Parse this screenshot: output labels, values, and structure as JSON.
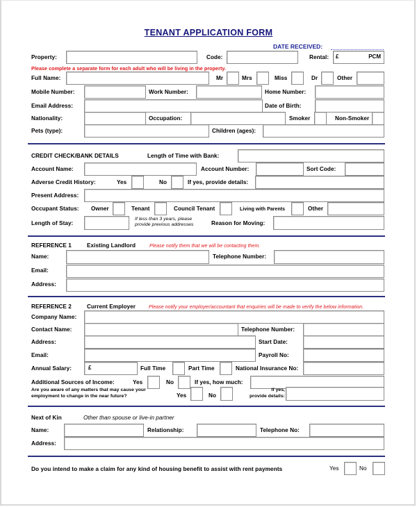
{
  "form": {
    "title": "TENANT APPLICATION FORM",
    "date_received_label": "DATE RECEIVED:",
    "property_label": "Property:",
    "code_label": "Code:",
    "rental_label": "Rental:",
    "rental_currency": "£",
    "rental_unit": "PCM",
    "separate_form_notice": "Please complete a separate form for each adult who will be living in the property."
  },
  "personal": {
    "full_name_label": "Full Name:",
    "titles": [
      "Mr",
      "Mrs",
      "Miss",
      "Dr",
      "Other"
    ],
    "mobile_label": "Mobile Number:",
    "work_label": "Work Number:",
    "home_label": "Home Number:",
    "email_label": "Email Address:",
    "dob_label": "Date of Birth:",
    "nationality_label": "Nationality:",
    "occupation_label": "Occupation:",
    "smoker_label": "Smoker",
    "non_smoker_label": "Non-Smoker",
    "pets_label": "Pets (type):",
    "children_label": "Children (ages):"
  },
  "credit": {
    "heading": "CREDIT CHECK/BANK DETAILS",
    "length_bank_label": "Length of Time with Bank:",
    "account_name_label": "Account Name:",
    "account_number_label": "Account Number:",
    "sort_code_label": "Sort Code:",
    "adverse_label": "Adverse Credit History:",
    "yes_label": "Yes",
    "no_label": "No",
    "if_yes_details_label": "If yes, provide details:",
    "present_address_label": "Present Address:",
    "occupant_status_label": "Occupant Status:",
    "statuses": [
      "Owner",
      "Tenant",
      "Council Tenant",
      "Living with Parents",
      "Other"
    ],
    "length_stay_label": "Length of Stay:",
    "stay_note_line1": "If less than 3 years, please",
    "stay_note_line2": "provide previous addresses",
    "reason_moving_label": "Reason for Moving:"
  },
  "reference1": {
    "heading": "REFERENCE 1",
    "subheading": "Existing Landlord",
    "notice": "Please notify them that we will be contacting them.",
    "name_label": "Name:",
    "telephone_label": "Telephone Number:",
    "email_label": "Email:",
    "address_label": "Address:"
  },
  "reference2": {
    "heading": "REFERENCE 2",
    "subheading": "Current Employer",
    "notice": "Please notify your employer/accountant that enquiries will be made to verify the below information.",
    "company_label": "Company Name:",
    "contact_label": "Contact Name:",
    "telephone_label": "Telephone Number:",
    "address_label": "Address:",
    "start_date_label": "Start Date:",
    "email_label": "Email:",
    "payroll_label": "Payroll No:",
    "salary_label": "Annual Salary:",
    "salary_currency": "£",
    "full_time_label": "Full Time",
    "part_time_label": "Part Time",
    "ni_label": "National Insurance No:",
    "additional_income_label": "Additional Sources of Income:",
    "yes_label": "Yes",
    "no_label": "No",
    "how_much_label": "If yes, how much:",
    "matters_line1": "Are you aware of any matters that may cause your",
    "matters_line2": "employment to change in the near future?",
    "if_yes_line1": "If yes,",
    "if_yes_line2": "provide details:"
  },
  "next_of_kin": {
    "heading": "Next of Kin",
    "note": "Other than spouse or live-in partner",
    "name_label": "Name:",
    "relationship_label": "Relationship:",
    "telephone_label": "Telephone No:",
    "address_label": "Address:"
  },
  "housing_benefit": {
    "question": "Do you intend to make a claim for any kind of housing benefit to assist with rent payments",
    "yes_label": "Yes",
    "no_label": "No"
  }
}
